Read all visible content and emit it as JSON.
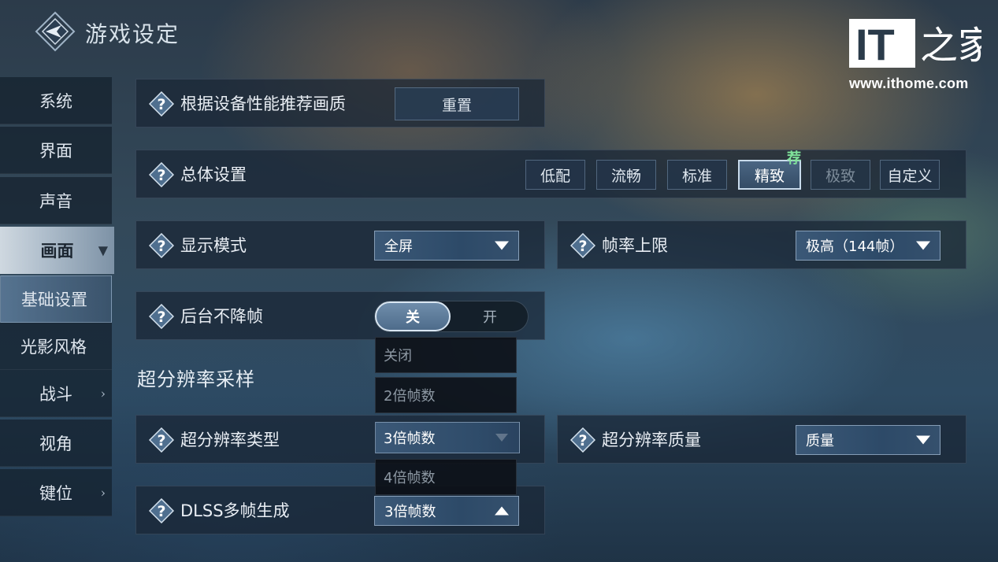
{
  "header": {
    "title": "游戏设定",
    "logo_icon": "game-emblem-icon"
  },
  "watermark": {
    "brand": "IT之家",
    "url": "www.ithome.com"
  },
  "sidebar": {
    "items": [
      {
        "label": "系统"
      },
      {
        "label": "界面"
      },
      {
        "label": "声音"
      },
      {
        "label": "画面",
        "expanded": true
      },
      {
        "label": "基础设置",
        "selected": true
      },
      {
        "label": "光影风格"
      },
      {
        "label": "战斗"
      },
      {
        "label": "视角"
      },
      {
        "label": "键位"
      }
    ]
  },
  "settings": {
    "recommend": {
      "label": "根据设备性能推荐画质",
      "button": "重置"
    },
    "overall": {
      "label": "总体设置",
      "options": [
        "低配",
        "流畅",
        "标准",
        "精致",
        "极致",
        "自定义"
      ],
      "selected": "精致",
      "disabled": "极致",
      "recommend_tag": "荐"
    },
    "display_mode": {
      "label": "显示模式",
      "value": "全屏"
    },
    "fps_limit": {
      "label": "帧率上限",
      "value": "极高（144帧）"
    },
    "background_fps": {
      "label": "后台不降帧",
      "off": "关",
      "on": "开",
      "state": "关"
    },
    "super_res_section": "超分辨率采样",
    "super_res_type": {
      "label": "超分辨率类型"
    },
    "super_res_quality": {
      "label": "超分辨率质量",
      "value": "质量"
    },
    "dlss": {
      "label": "DLSS多帧生成",
      "value": "3倍帧数",
      "open": true
    },
    "dlss_options": [
      "关闭",
      "2倍帧数",
      "3倍帧数",
      "4倍帧数"
    ],
    "dlss_current": "3倍帧数"
  },
  "colors": {
    "accent": "#c9dbec",
    "recommend_green": "#7fe29a",
    "panel": "#19253a"
  }
}
